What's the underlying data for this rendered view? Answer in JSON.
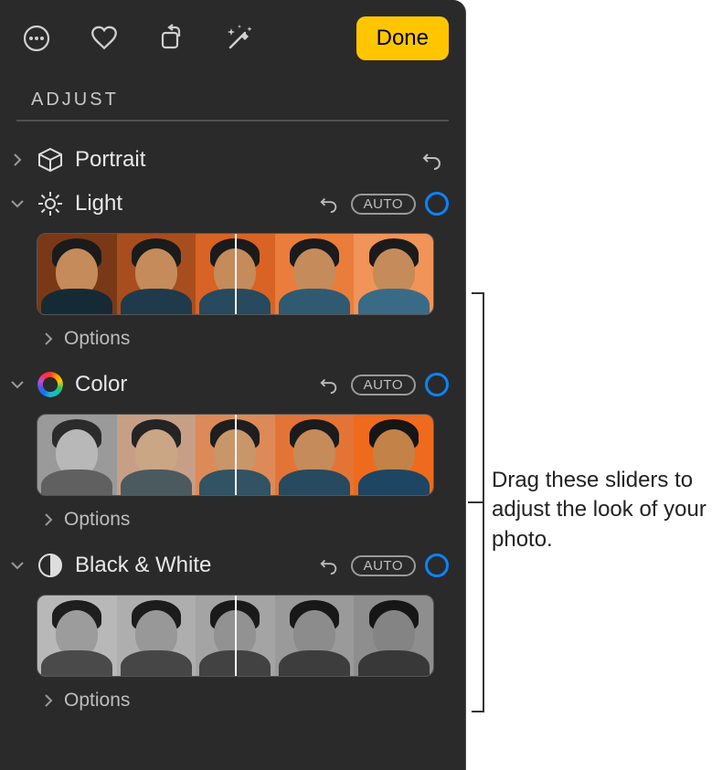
{
  "toolbar": {
    "done_label": "Done"
  },
  "section": {
    "title": "ADJUST"
  },
  "adjustments": {
    "portrait": {
      "label": "Portrait"
    },
    "light": {
      "label": "Light",
      "auto_label": "AUTO",
      "options_label": "Options"
    },
    "color": {
      "label": "Color",
      "auto_label": "AUTO",
      "options_label": "Options"
    },
    "bw": {
      "label": "Black & White",
      "auto_label": "AUTO",
      "options_label": "Options"
    }
  },
  "callout": {
    "text": "Drag these sliders to adjust the look of your photo."
  },
  "thumb_palettes": {
    "light": [
      {
        "bg": "#7a3916",
        "body": "#162a36"
      },
      {
        "bg": "#a84e1e",
        "body": "#1f3a4a"
      },
      {
        "bg": "#d86325",
        "body": "#274a5e"
      },
      {
        "bg": "#ea7d3c",
        "body": "#2f5a72"
      },
      {
        "bg": "#f09458",
        "body": "#396b87"
      }
    ],
    "color": [
      {
        "bg": "#9a9a9a",
        "body": "#606060",
        "face": "#b8b8b8",
        "hair": "#2b2b2b"
      },
      {
        "bg": "#c79f86",
        "body": "#4b5a5e",
        "face": "#caa684",
        "hair": "#242424"
      },
      {
        "bg": "#dd8a58",
        "body": "#315363",
        "face": "#c9966a",
        "hair": "#1e1e1e"
      },
      {
        "bg": "#e47436",
        "body": "#274a5e",
        "face": "#c58b5a",
        "hair": "#1b1b1b"
      },
      {
        "bg": "#ef6a1d",
        "body": "#1e4662",
        "face": "#c38248",
        "hair": "#161616"
      }
    ],
    "bw": [
      {
        "bg": "#b8b8b8",
        "body": "#4a4a4a",
        "face": "#9c9c9c",
        "hair": "#1e1e1e"
      },
      {
        "bg": "#aeaeae",
        "body": "#464646",
        "face": "#989898",
        "hair": "#1c1c1c"
      },
      {
        "bg": "#a4a4a4",
        "body": "#424242",
        "face": "#929292",
        "hair": "#1a1a1a"
      },
      {
        "bg": "#9a9a9a",
        "body": "#3d3d3d",
        "face": "#8c8c8c",
        "hair": "#181818"
      },
      {
        "bg": "#8e8e8e",
        "body": "#383838",
        "face": "#848484",
        "hair": "#161616"
      }
    ]
  }
}
